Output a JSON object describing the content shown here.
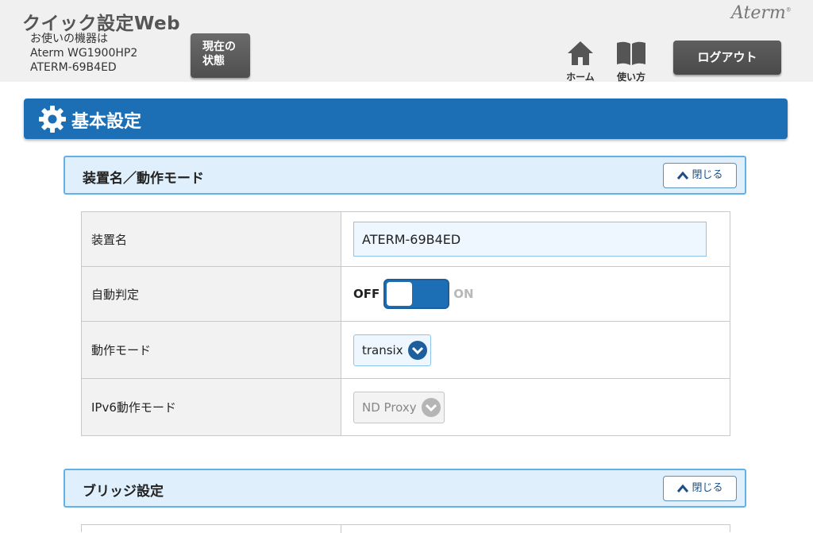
{
  "header": {
    "app_title": "クイック設定Web",
    "device_label": "お使いの機器は",
    "device_model": "Aterm WG1900HP2",
    "device_name": "ATERM-69B4ED",
    "status_button": [
      "現在の",
      "状態"
    ],
    "brand": "Aterm",
    "home_label": "ホーム",
    "help_label": "使い方",
    "logout_label": "ログアウト"
  },
  "banner": {
    "icon": "gear-icon",
    "title": "基本設定"
  },
  "panels": [
    {
      "title": "装置名／動作モード",
      "close_label": "閉じる",
      "rows": [
        {
          "label": "装置名",
          "value": "ATERM-69B4ED"
        },
        {
          "label": "自動判定",
          "off_label": "OFF",
          "on_label": "ON",
          "state": "OFF"
        },
        {
          "label": "動作モード",
          "value": "transix"
        },
        {
          "label": "IPv6動作モード",
          "value": "ND Proxy",
          "disabled": true
        }
      ]
    },
    {
      "title": "ブリッジ設定",
      "close_label": "閉じる"
    }
  ],
  "colors": {
    "accent": "#1c6fb5",
    "panel_header_bg": "#dfeffb",
    "panel_header_border": "#64b1e8",
    "header_bg": "#f0f0f0"
  }
}
